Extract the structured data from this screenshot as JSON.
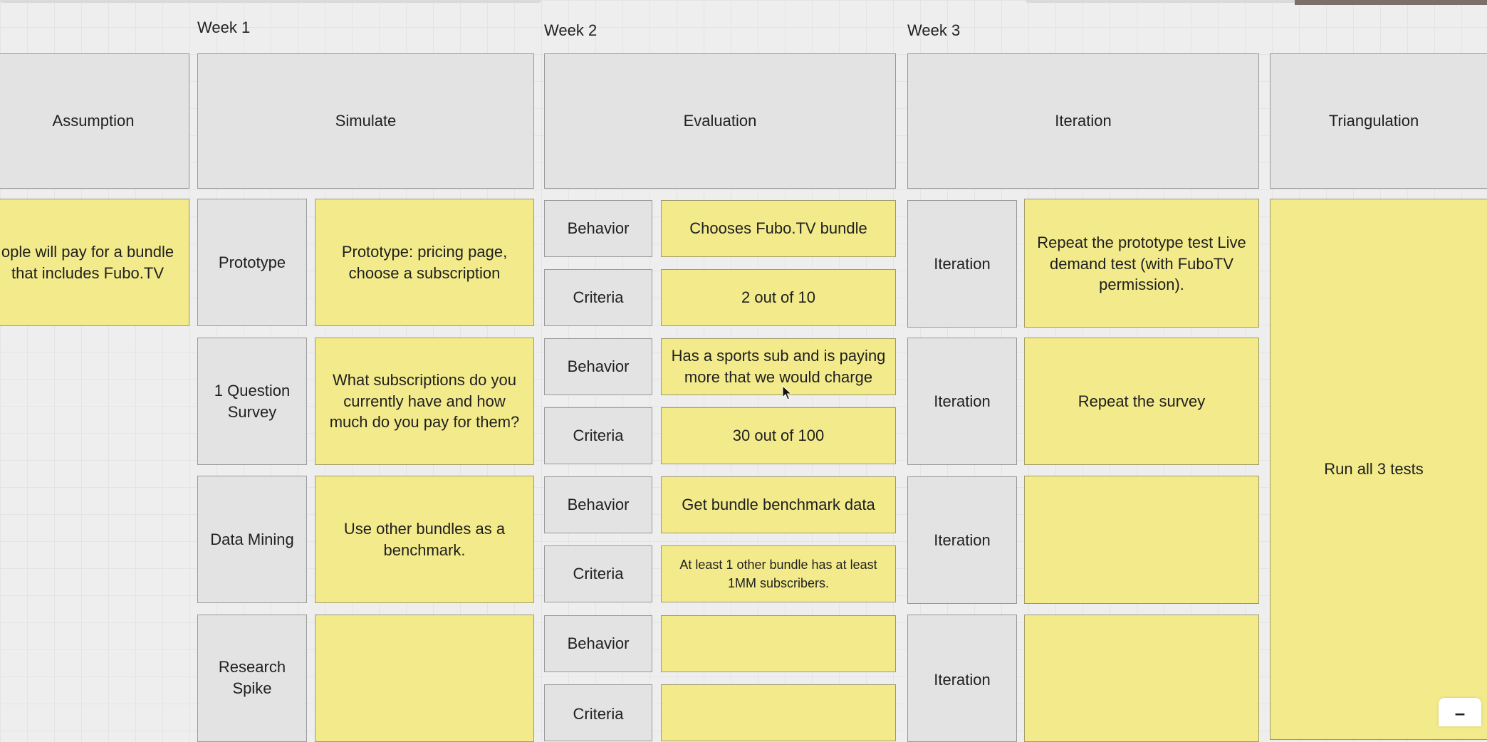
{
  "weeks": [
    "Week 1",
    "Week 2",
    "Week 3"
  ],
  "headers": {
    "assumption": "Assumption",
    "simulate": "Simulate",
    "evaluation": "Evaluation",
    "iteration": "Iteration",
    "triangulation": "Triangulation"
  },
  "assumption_text": "ople will pay for a bundle that includes Fubo.TV",
  "rows": [
    {
      "method": "Prototype",
      "simulate": "Prototype: pricing page, choose a subscription",
      "behavior_label": "Behavior",
      "behavior": "Chooses Fubo.TV bundle",
      "criteria_label": "Criteria",
      "criteria": "2 out of 10",
      "iteration_label": "Iteration",
      "iteration": "Repeat the prototype test Live demand test (with FuboTV permission)."
    },
    {
      "method": "1 Question Survey",
      "simulate": "What subscriptions do you currently have and how much do you pay for them?",
      "behavior_label": "Behavior",
      "behavior": "Has a sports sub and is paying more that we would charge",
      "criteria_label": "Criteria",
      "criteria": "30 out of 100",
      "iteration_label": "Iteration",
      "iteration": "Repeat the survey"
    },
    {
      "method": "Data Mining",
      "simulate": "Use other bundles as a benchmark.",
      "behavior_label": "Behavior",
      "behavior": "Get bundle benchmark data",
      "criteria_label": "Criteria",
      "criteria": "At least 1 other bundle has at least 1MM subscribers.",
      "iteration_label": "Iteration",
      "iteration": ""
    },
    {
      "method": "Research Spike",
      "simulate": "",
      "behavior_label": "Behavior",
      "behavior": "",
      "criteria_label": "Criteria",
      "criteria": "",
      "iteration_label": "Iteration",
      "iteration": ""
    }
  ],
  "triangulation_text": "Run all 3 tests",
  "zoom_control_symbol": "–"
}
